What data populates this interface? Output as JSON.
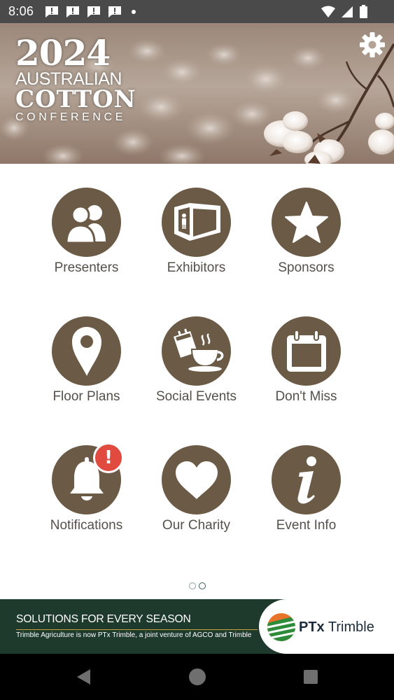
{
  "status_bar": {
    "time": "8:06",
    "notification_icons": [
      "alert-notification-icon",
      "alert-notification-icon",
      "alert-notification-icon",
      "alert-notification-icon"
    ],
    "icons": [
      "wifi-icon",
      "cellular-signal-icon",
      "battery-icon"
    ]
  },
  "banner": {
    "logo": {
      "year": "2024",
      "line1": "AUSTRALIAN",
      "line2": "COTTON",
      "line3": "CONFERENCE"
    },
    "settings_icon": "gear-icon"
  },
  "menu": {
    "items": [
      {
        "label": "Presenters",
        "icon": "people-icon"
      },
      {
        "label": "Exhibitors",
        "icon": "booth-icon"
      },
      {
        "label": "Sponsors",
        "icon": "star-icon"
      },
      {
        "label": "Floor Plans",
        "icon": "map-pin-icon"
      },
      {
        "label": "Social Events",
        "icon": "coffee-cup-icon"
      },
      {
        "label": "Don't Miss",
        "icon": "calendar-icon"
      },
      {
        "label": "Notifications",
        "icon": "bell-icon",
        "badge": "!"
      },
      {
        "label": "Our Charity",
        "icon": "heart-icon"
      },
      {
        "label": "Event Info",
        "icon": "info-icon"
      }
    ]
  },
  "pager": {
    "pages": 2,
    "current": 2
  },
  "ad": {
    "headline": "SOLUTIONS FOR EVERY SEASON",
    "subtext": "Trimble Agriculture is now PTx Trimble, a joint venture of AGCO and Trimble",
    "brand_prefix": "PTx",
    "brand_name": " Trimble"
  },
  "nav_bar": {
    "buttons": [
      "back-icon",
      "home-icon",
      "recents-icon"
    ]
  },
  "colors": {
    "icon_circle": "#6b5a45",
    "label_text": "#555049",
    "badge": "#e04a3f",
    "ad_background": "#1e3a2d",
    "status_bar": "#4a4a4a"
  }
}
